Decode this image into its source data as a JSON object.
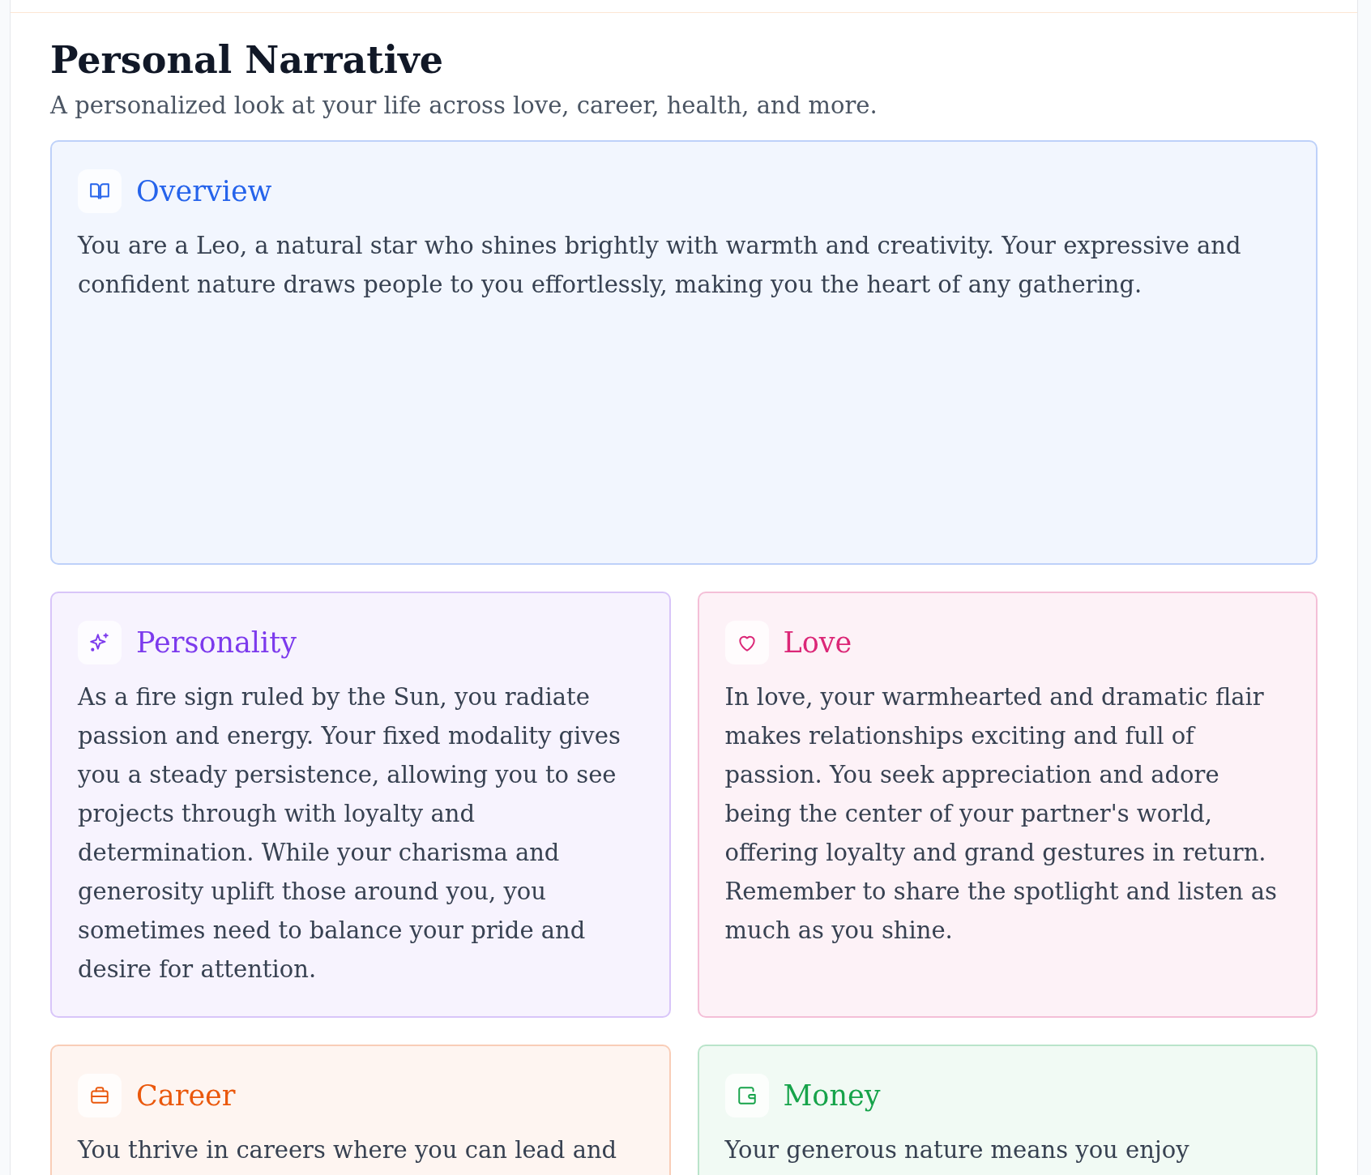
{
  "title": "Personal Narrative",
  "subtitle": "A personalized look at your life across love, career, health, and more.",
  "sections": [
    {
      "kind": "book",
      "title": "Overview",
      "color": "#2563eb",
      "text": "You are a Leo, a natural star who shines brightly with warmth and creativity. Your expressive and confident nature draws people to you effortlessly, making you the heart of any gathering."
    },
    {
      "kind": "sparkles",
      "title": "Personality",
      "color": "#7c3aed",
      "text": "As a fire sign ruled by the Sun, you radiate passion and energy. Your fixed modality gives you a steady persistence, allowing you to see projects through with loyalty and determination. While your charisma and generosity uplift those around you, you sometimes need to balance your pride and desire for attention."
    },
    {
      "kind": "heart",
      "title": "Love",
      "color": "#db2777",
      "text": "In love, your warmhearted and dramatic flair makes relationships exciting and full of passion. You seek appreciation and adore being the center of your partner's world, offering loyalty and grand gestures in return. Remember to share the spotlight and listen as much as you shine."
    },
    {
      "kind": "briefcase",
      "title": "Career",
      "color": "#ea580c",
      "text": "You thrive in careers where you can lead and"
    },
    {
      "kind": "wallet",
      "title": "Money",
      "color": "#16a34a",
      "text": "Your generous nature means you enjoy"
    }
  ]
}
